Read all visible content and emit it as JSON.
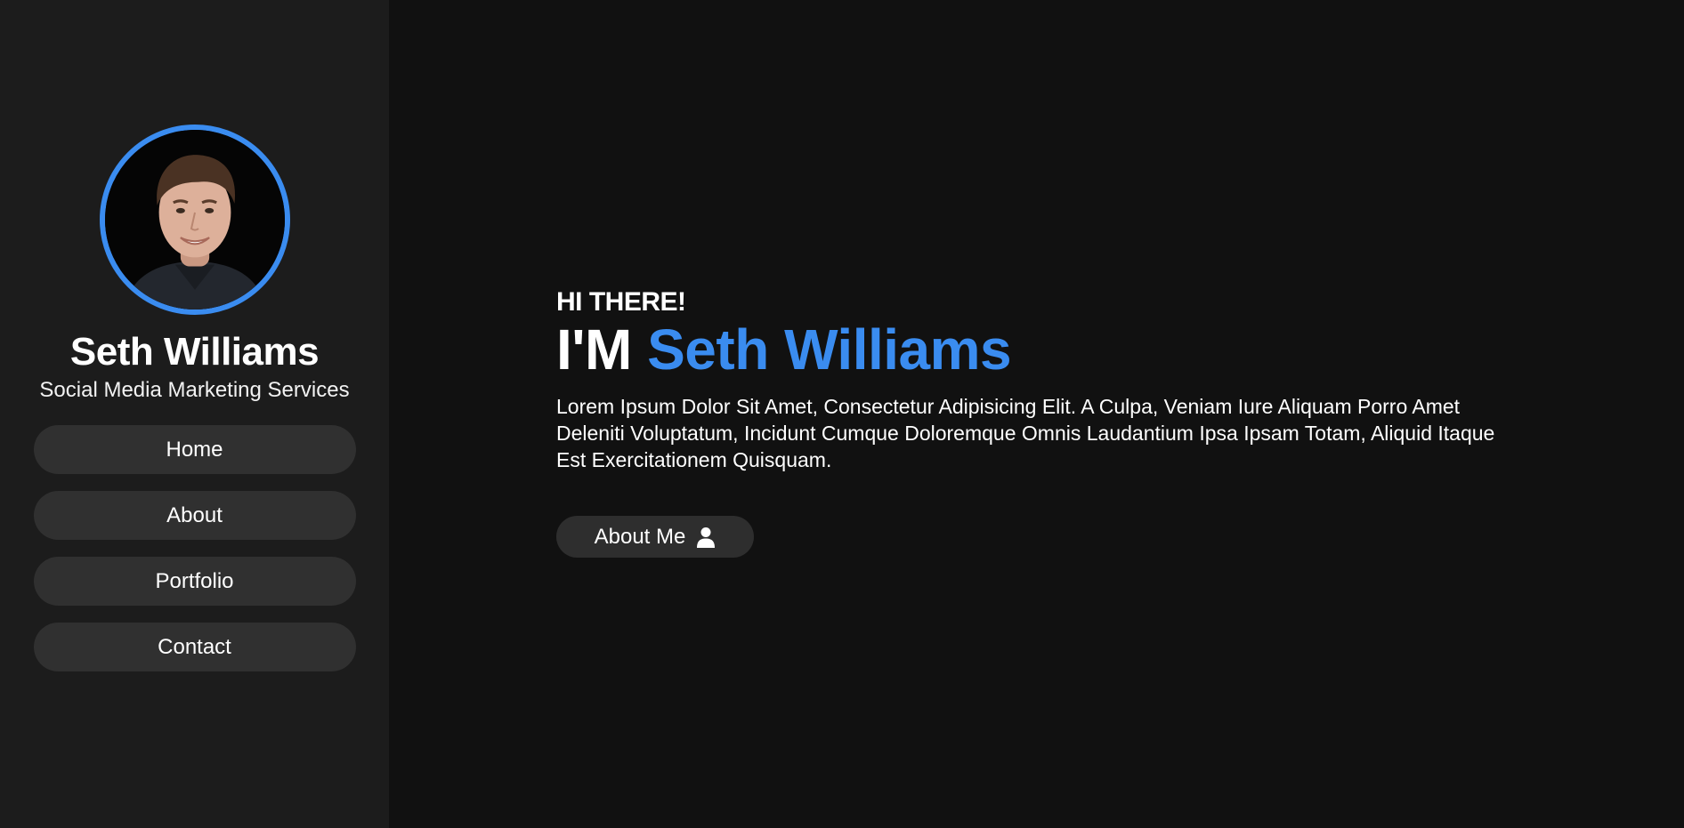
{
  "sidebar": {
    "profile": {
      "name": "Seth Williams",
      "subtitle": "Social Media Marketing Services",
      "avatar_icon": "portrait-photo"
    },
    "nav": [
      {
        "label": "Home"
      },
      {
        "label": "About"
      },
      {
        "label": "Portfolio"
      },
      {
        "label": "Contact"
      }
    ]
  },
  "hero": {
    "greeting": "HI THERE!",
    "headline_prefix": "I'M",
    "headline_name": "Seth Williams",
    "intro": "Lorem Ipsum Dolor Sit Amet, Consectetur Adipisicing Elit. A Culpa, Veniam Iure Aliquam Porro Amet Deleniti Voluptatum, Incidunt Cumque Doloremque Omnis Laudantium Ipsa Ipsam Totam, Aliquid Itaque Est Exercitationem Quisquam.",
    "cta_label": "About Me",
    "cta_icon": "user-icon"
  },
  "colors": {
    "accent": "#3a8cf0",
    "sidebar_bg": "#1c1c1c",
    "main_bg": "#111111",
    "button_bg": "#303030"
  }
}
